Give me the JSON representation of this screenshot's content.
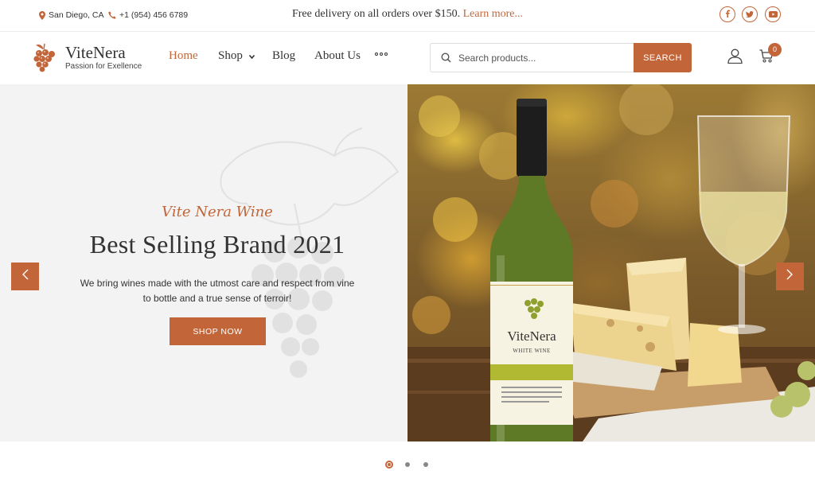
{
  "topbar": {
    "location": "San Diego, CA",
    "phone": "+1 (954) 456 6789",
    "promo_text": "Free delivery on all orders over $150.",
    "promo_link": "Learn more...",
    "social": [
      "facebook-icon",
      "twitter-icon",
      "youtube-icon"
    ]
  },
  "header": {
    "brand": "ViteNera",
    "tagline": "Passion for Exellence",
    "nav": {
      "home": "Home",
      "shop": "Shop",
      "blog": "Blog",
      "about": "About Us"
    },
    "search": {
      "placeholder": "Search products...",
      "button": "SEARCH"
    },
    "cart_count": "0"
  },
  "hero": {
    "script": "Vite Nera Wine",
    "title": "Best Selling Brand 2021",
    "description": "We bring wines made with the utmost care and respect from vine to bottle and a true sense of terroir!",
    "button": "SHOP NOW",
    "bottle_label": {
      "brand": "ViteNera",
      "variety": "WHITE WINE"
    }
  },
  "slider": {
    "slide_count": 3,
    "active_slide": 1
  },
  "colors": {
    "accent": "#c2663a",
    "text": "#333333",
    "hero_bg": "#f3f3f3"
  }
}
